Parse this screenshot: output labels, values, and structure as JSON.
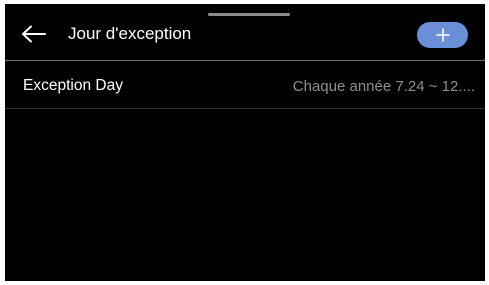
{
  "header": {
    "title": "Jour d'exception",
    "back_icon": "arrow-left-icon",
    "add_icon": "plus-icon"
  },
  "exceptions": [
    {
      "name": "Exception Day",
      "value": "Chaque année 7.24 ~ 12...."
    }
  ],
  "colors": {
    "background": "#000000",
    "accent": "#6a8fd6",
    "primary_text": "#ffffff",
    "secondary_text": "#8f8f8f"
  }
}
